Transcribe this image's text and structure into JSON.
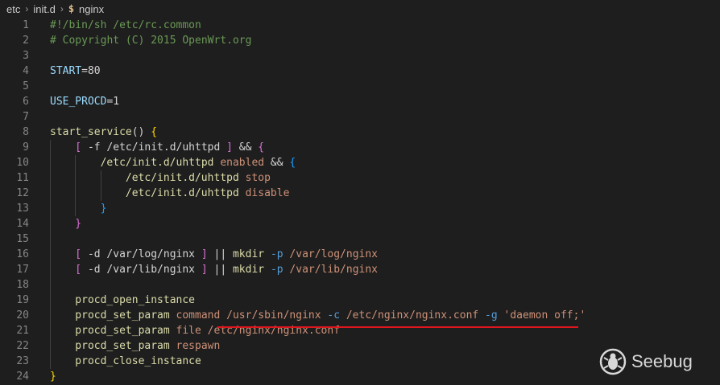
{
  "breadcrumb": {
    "items": [
      "etc",
      "init.d",
      "nginx"
    ],
    "file_icon": "shell-script-icon",
    "file_icon_glyph": "$"
  },
  "editor": {
    "lines": [
      {
        "n": "1",
        "indent": 0,
        "tokens": [
          {
            "t": "#!/bin/sh /etc/rc.common",
            "c": "comment"
          }
        ]
      },
      {
        "n": "2",
        "indent": 0,
        "tokens": [
          {
            "t": "# Copyright (C) 2015 OpenWrt.org",
            "c": "comment"
          }
        ]
      },
      {
        "n": "3",
        "indent": 0,
        "tokens": []
      },
      {
        "n": "4",
        "indent": 0,
        "tokens": [
          {
            "t": "START",
            "c": "var"
          },
          {
            "t": "=80",
            "c": "plain"
          }
        ]
      },
      {
        "n": "5",
        "indent": 0,
        "tokens": []
      },
      {
        "n": "6",
        "indent": 0,
        "tokens": [
          {
            "t": "USE_PROCD",
            "c": "var"
          },
          {
            "t": "=1",
            "c": "plain"
          }
        ]
      },
      {
        "n": "7",
        "indent": 0,
        "tokens": []
      },
      {
        "n": "8",
        "indent": 0,
        "tokens": [
          {
            "t": "start_service",
            "c": "fn"
          },
          {
            "t": "() ",
            "c": "plain"
          },
          {
            "t": "{",
            "c": "b1"
          }
        ]
      },
      {
        "n": "9",
        "indent": 1,
        "tokens": [
          {
            "t": "[",
            "c": "b2"
          },
          {
            "t": " -f /etc/init.d/uhttpd ",
            "c": "plain"
          },
          {
            "t": "]",
            "c": "b2"
          },
          {
            "t": " && ",
            "c": "plain"
          },
          {
            "t": "{",
            "c": "b2"
          }
        ]
      },
      {
        "n": "10",
        "indent": 2,
        "tokens": [
          {
            "t": "/etc/init.d/uhttpd ",
            "c": "fn"
          },
          {
            "t": "enabled",
            "c": "str"
          },
          {
            "t": " && ",
            "c": "plain"
          },
          {
            "t": "{",
            "c": "b3"
          }
        ]
      },
      {
        "n": "11",
        "indent": 3,
        "tokens": [
          {
            "t": "/etc/init.d/uhttpd ",
            "c": "fn"
          },
          {
            "t": "stop",
            "c": "str"
          }
        ]
      },
      {
        "n": "12",
        "indent": 3,
        "tokens": [
          {
            "t": "/etc/init.d/uhttpd ",
            "c": "fn"
          },
          {
            "t": "disable",
            "c": "str"
          }
        ]
      },
      {
        "n": "13",
        "indent": 2,
        "tokens": [
          {
            "t": "}",
            "c": "b3"
          }
        ]
      },
      {
        "n": "14",
        "indent": 1,
        "tokens": [
          {
            "t": "}",
            "c": "b2"
          }
        ]
      },
      {
        "n": "15",
        "indent": 1,
        "tokens": []
      },
      {
        "n": "16",
        "indent": 1,
        "tokens": [
          {
            "t": "[",
            "c": "b2"
          },
          {
            "t": " -d /var/log/nginx ",
            "c": "plain"
          },
          {
            "t": "]",
            "c": "b2"
          },
          {
            "t": " || ",
            "c": "plain"
          },
          {
            "t": "mkdir",
            "c": "fn"
          },
          {
            "t": " ",
            "c": "plain"
          },
          {
            "t": "-p",
            "c": "opt"
          },
          {
            "t": " /var/log/nginx",
            "c": "str"
          }
        ]
      },
      {
        "n": "17",
        "indent": 1,
        "tokens": [
          {
            "t": "[",
            "c": "b2"
          },
          {
            "t": " -d /var/lib/nginx ",
            "c": "plain"
          },
          {
            "t": "]",
            "c": "b2"
          },
          {
            "t": " || ",
            "c": "plain"
          },
          {
            "t": "mkdir",
            "c": "fn"
          },
          {
            "t": " ",
            "c": "plain"
          },
          {
            "t": "-p",
            "c": "opt"
          },
          {
            "t": " /var/lib/nginx",
            "c": "str"
          }
        ]
      },
      {
        "n": "18",
        "indent": 1,
        "tokens": []
      },
      {
        "n": "19",
        "indent": 1,
        "tokens": [
          {
            "t": "procd_open_instance",
            "c": "fn"
          }
        ]
      },
      {
        "n": "20",
        "indent": 1,
        "tokens": [
          {
            "t": "procd_set_param",
            "c": "fn"
          },
          {
            "t": " command /usr/sbin/nginx ",
            "c": "str"
          },
          {
            "t": "-c",
            "c": "opt"
          },
          {
            "t": " /etc/nginx/nginx.conf ",
            "c": "str"
          },
          {
            "t": "-g",
            "c": "opt"
          },
          {
            "t": " 'daemon off;'",
            "c": "str"
          }
        ]
      },
      {
        "n": "21",
        "indent": 1,
        "tokens": [
          {
            "t": "procd_set_param",
            "c": "fn"
          },
          {
            "t": " file /etc/nginx/nginx.conf",
            "c": "str"
          }
        ]
      },
      {
        "n": "22",
        "indent": 1,
        "tokens": [
          {
            "t": "procd_set_param",
            "c": "fn"
          },
          {
            "t": " respawn",
            "c": "str"
          }
        ]
      },
      {
        "n": "23",
        "indent": 1,
        "tokens": [
          {
            "t": "procd_close_instance",
            "c": "fn"
          }
        ]
      },
      {
        "n": "24",
        "indent": 0,
        "tokens": [
          {
            "t": "}",
            "c": "b1"
          }
        ]
      }
    ]
  },
  "annotation": {
    "underline_color": "#e0161e"
  },
  "watermark": {
    "text": "Seebug",
    "icon": "seebug-bug-logo-icon"
  },
  "colors": {
    "background": "#1e1e1e",
    "comment": "#6a9955",
    "variable": "#9cdcfe",
    "function": "#dcdcaa",
    "string": "#ce9178",
    "option": "#569cd6",
    "bracket_level1": "#ffd700",
    "bracket_level2": "#da70d6",
    "bracket_level3": "#179fff"
  }
}
